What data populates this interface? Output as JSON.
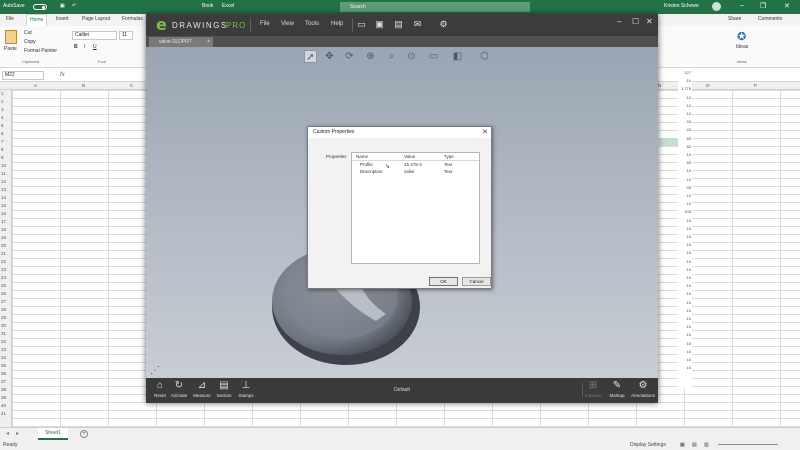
{
  "excel": {
    "autosave_label": "AutoSave",
    "title_file": "Book",
    "title_app": "Excel",
    "search_placeholder": "Search",
    "user_name": "Kristen Schewe",
    "tabs": [
      "File",
      "Home",
      "Insert",
      "Page Layout",
      "Formulas"
    ],
    "tabs_right": [
      "Share",
      "Comments"
    ],
    "ribbon": {
      "paste": "Paste",
      "cut": "Cut",
      "copy": "Copy",
      "format_painter": "Format Painter",
      "clipboard": "Clipboard",
      "font_name": "Calibri",
      "font_size": "11",
      "font_group": "Font",
      "ideas": "Ideas",
      "ideas_group": "Ideas"
    },
    "name_box": "M22",
    "columns": [
      "A",
      "B",
      "C",
      "D",
      "E",
      "F",
      "G",
      "H",
      "I",
      "J",
      "K",
      "L",
      "M",
      "N",
      "O",
      "P",
      "Q"
    ],
    "rows": [
      "1",
      "2",
      "3",
      "4",
      "5",
      "6",
      "7",
      "8",
      "9",
      "10",
      "11",
      "12",
      "13",
      "14",
      "15",
      "16",
      "17",
      "18",
      "19",
      "20",
      "21",
      "22",
      "23",
      "24",
      "25",
      "26",
      "27",
      "28",
      "29",
      "30",
      "31",
      "32",
      "33",
      "34",
      "35",
      "36",
      "37",
      "38",
      "39",
      "40",
      "41"
    ],
    "right_values": [
      "127",
      "10",
      "1,775",
      "10",
      "10",
      "10",
      "93",
      "43",
      "63",
      "62",
      "10",
      "63",
      "10",
      "10",
      "05",
      "10",
      "10",
      "103",
      "10",
      "10",
      "10",
      "10",
      "10",
      "10",
      "10",
      "10",
      "10",
      "10",
      "10",
      "10",
      "10",
      "10",
      "10",
      "10",
      "10",
      "10",
      "10"
    ],
    "sheet_tab": "Sheet1",
    "status_ready": "Ready",
    "status_display": "Display Settings"
  },
  "edrawings": {
    "logo_e": "e",
    "logo_text": "DRAWINGS",
    "logo_pro": "PRO",
    "menu": [
      "File",
      "View",
      "Tools",
      "Help"
    ],
    "doc_tab": "valve.SLDPRT",
    "bottom_tools": [
      {
        "label": "Reset",
        "icon": "⌂",
        "name": "reset"
      },
      {
        "label": "Animate",
        "icon": "↻",
        "name": "animate"
      },
      {
        "label": "Measure",
        "icon": "⊿",
        "name": "measure"
      },
      {
        "label": "Section",
        "icon": "▤",
        "name": "section"
      },
      {
        "label": "Stamps",
        "icon": "⊥",
        "name": "stamps"
      }
    ],
    "bottom_right_tools": [
      {
        "label": "Explode",
        "icon": "⊞",
        "name": "explode"
      },
      {
        "label": "Markup",
        "icon": "✎",
        "name": "markup"
      },
      {
        "label": "Annotations",
        "icon": "⚙",
        "name": "annotations"
      }
    ],
    "configuration": "Default",
    "colors": {
      "accent": "#7bbe3e",
      "bar": "#3c3c3c",
      "viewport_top": "#9aa5b3",
      "viewport_bottom": "#c8cdd4"
    }
  },
  "dialog": {
    "title": "Custom Properties",
    "field_label": "Properties",
    "headers": [
      "Name",
      "Value",
      "Type"
    ],
    "rows": [
      {
        "name": "Profile",
        "value": "15 475-3",
        "type": "Text"
      },
      {
        "name": "Description",
        "value": "valve",
        "type": "Text"
      }
    ],
    "ok": "OK",
    "cancel": "Cancel"
  }
}
